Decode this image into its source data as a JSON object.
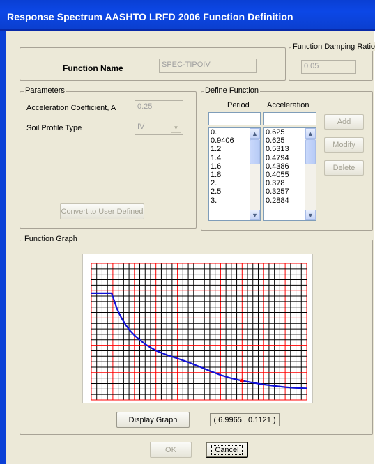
{
  "window": {
    "title": "Response Spectrum AASHTO LRFD 2006 Function Definition"
  },
  "function_name": {
    "label": "Function Name",
    "value": "SPEC-TIPOIV"
  },
  "damping": {
    "legend": "Function Damping Ratio",
    "value": "0.05"
  },
  "parameters": {
    "legend": "Parameters",
    "accel_label": "Acceleration Coefficient, A",
    "accel_value": "0.25",
    "soil_label": "Soil Profile Type",
    "soil_value": "IV",
    "convert_button": "Convert to User Defined"
  },
  "define_function": {
    "legend": "Define Function",
    "period_header": "Period",
    "acceleration_header": "Acceleration",
    "periods": [
      "0.",
      "0.9406",
      "1.2",
      "1.4",
      "1.6",
      "1.8",
      "2.",
      "2.5",
      "3."
    ],
    "accelerations": [
      "0.625",
      "0.625",
      "0.5313",
      "0.4794",
      "0.4386",
      "0.4055",
      "0.378",
      "0.3257",
      "0.2884"
    ],
    "add_button": "Add",
    "modify_button": "Modify",
    "delete_button": "Delete"
  },
  "graph": {
    "legend": "Function Graph",
    "display_button": "Display Graph",
    "cursor_readout": "( 6.9965 ,  0.1121 )",
    "colors": {
      "curve": "#1010d8",
      "marker": "#ff0000",
      "major_grid": "#ff0000",
      "minor_grid": "#000000",
      "background": "#ffffff"
    }
  },
  "chart_data": {
    "type": "line",
    "title": "",
    "xlabel": "",
    "ylabel": "",
    "grid": true,
    "series": [
      {
        "x": [
          0,
          0.9406,
          1.2,
          1.4,
          1.6,
          1.8,
          2.0,
          2.5,
          3.0,
          3.5,
          4.0,
          4.5,
          5.0,
          5.5,
          6.0,
          6.5,
          7.0,
          7.5,
          8.0,
          8.5,
          9.0,
          9.5,
          10.0
        ],
        "y": [
          0.625,
          0.625,
          0.5313,
          0.4794,
          0.4386,
          0.4055,
          0.378,
          0.3257,
          0.2884,
          0.2635,
          0.243,
          0.221,
          0.196,
          0.17,
          0.146,
          0.127,
          0.1121,
          0.101,
          0.09,
          0.082,
          0.075,
          0.07,
          0.068
        ]
      }
    ],
    "marker": {
      "x": 6.9965,
      "y": 0.1121
    },
    "xlim": [
      0,
      10
    ],
    "ylim": [
      0,
      0.8
    ]
  },
  "footer": {
    "ok_button": "OK",
    "cancel_button": "Cancel"
  }
}
